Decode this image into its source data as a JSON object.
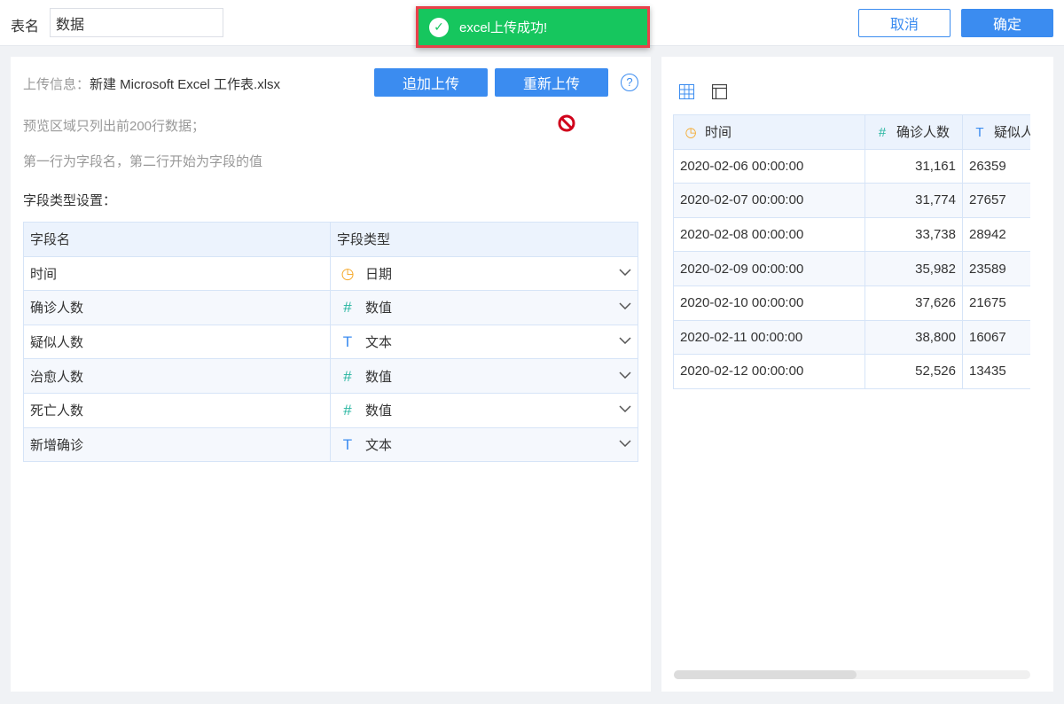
{
  "header": {
    "table_name_label": "表名",
    "table_name_value": "数据",
    "cancel": "取消",
    "confirm": "确定"
  },
  "toast": {
    "message": "excel上传成功!"
  },
  "upload": {
    "info_label": "上传信息：",
    "file_name": "新建 Microsoft Excel 工作表.xlsx",
    "append": "追加上传",
    "reupload": "重新上传",
    "help": "?",
    "note1": "预览区域只列出前200行数据；",
    "note2": "第一行为字段名，第二行开始为字段的值",
    "settings_title": "字段类型设置："
  },
  "fields": {
    "headers": [
      "字段名",
      "字段类型"
    ],
    "rows": [
      {
        "name": "时间",
        "type": "日期",
        "icon": "clock"
      },
      {
        "name": "确诊人数",
        "type": "数值",
        "icon": "#"
      },
      {
        "name": "疑似人数",
        "type": "文本",
        "icon": "T"
      },
      {
        "name": "治愈人数",
        "type": "数值",
        "icon": "#"
      },
      {
        "name": "死亡人数",
        "type": "数值",
        "icon": "#"
      },
      {
        "name": "新增确诊",
        "type": "文本",
        "icon": "T"
      }
    ]
  },
  "preview": {
    "headers": [
      "时间",
      "确诊人数",
      "疑似人数"
    ],
    "rows": [
      [
        "2020-02-06 00:00:00",
        "31,161",
        "26359"
      ],
      [
        "2020-02-07 00:00:00",
        "31,774",
        "27657"
      ],
      [
        "2020-02-08 00:00:00",
        "33,738",
        "28942"
      ],
      [
        "2020-02-09 00:00:00",
        "35,982",
        "23589"
      ],
      [
        "2020-02-10 00:00:00",
        "37,626",
        "21675"
      ],
      [
        "2020-02-11 00:00:00",
        "38,800",
        "16067"
      ],
      [
        "2020-02-12 00:00:00",
        "52,526",
        "13435"
      ]
    ]
  },
  "colors": {
    "primary": "#3b8cf0",
    "success": "#16c65e",
    "date_icon": "#f5a623",
    "num_icon": "#26b5a0",
    "text_icon": "#3b8cf0"
  }
}
